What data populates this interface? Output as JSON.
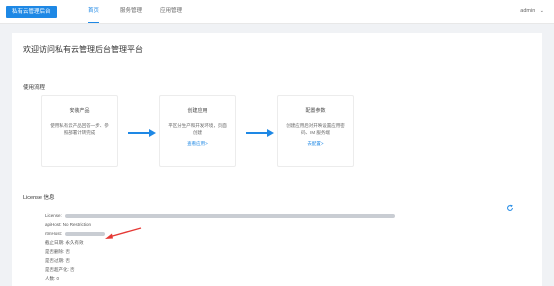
{
  "header": {
    "brand_label": "私有云管理后台",
    "nav": [
      {
        "label": "首页"
      },
      {
        "label": "服务管理"
      },
      {
        "label": "应用管理"
      }
    ],
    "user_name": "admin"
  },
  "main": {
    "title": "欢迎访问私有云管理后台管理平台",
    "process_label": "使用流程",
    "steps": [
      {
        "title": "安装产品",
        "desc": "使用私有云产品回答一步、参照部署计转完成",
        "link": ""
      },
      {
        "title": "创建应用",
        "desc": "平区分生产和开发环境，页面创建",
        "link": "查看应用>"
      },
      {
        "title": "配置参数",
        "desc": "创建应用后对开映设置应用密码、IM 服务端",
        "link": "去配置>"
      }
    ],
    "license_label": "License 信息",
    "license_rows": [
      {
        "label": "License:",
        "value": ""
      },
      {
        "label": "apiHost: No Restriction",
        "value": ""
      },
      {
        "label": "rtmHost:",
        "value": ""
      },
      {
        "label": "截止日期: 永久有效",
        "value": ""
      },
      {
        "label": "是否删除: 否",
        "value": ""
      },
      {
        "label": "是否过期: 否",
        "value": ""
      },
      {
        "label": "是否超产化: 否",
        "value": ""
      },
      {
        "label": "人数: 0",
        "value": ""
      }
    ]
  },
  "colors": {
    "accent": "#1e88e5",
    "arrow": "#1e88e5",
    "annotation": "#e53935"
  },
  "icons": {
    "refresh": "refresh-icon",
    "chevron": "chevron-down-icon"
  }
}
